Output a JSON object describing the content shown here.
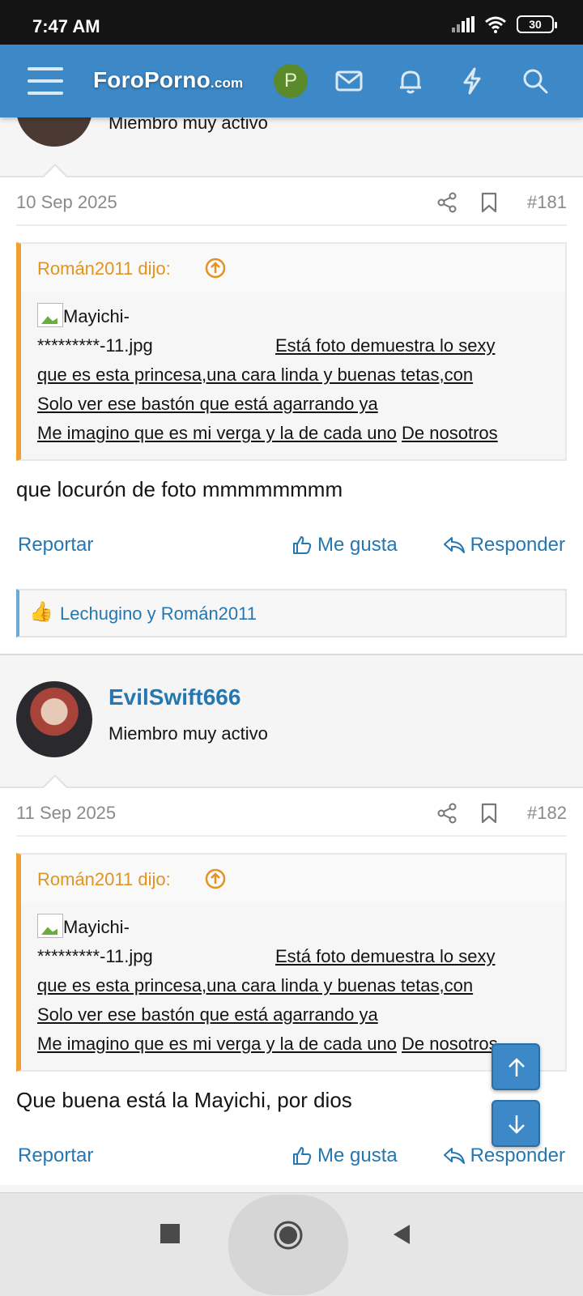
{
  "status_bar": {
    "time": "7:47 AM",
    "battery": "30"
  },
  "header": {
    "logo_main": "ForoPorno",
    "logo_tld": ".com",
    "user_initial": "P"
  },
  "top_user": {
    "title": "Miembro muy activo"
  },
  "posts": [
    {
      "date": "10 Sep 2025",
      "number": "#181",
      "quote": {
        "author": "Román2011 dijo:",
        "image_alt_1": "Mayichi-",
        "image_alt_2": "*********-11.jpg",
        "line1_tail": "Está foto demuestra lo sexy",
        "line2": "que es esta princesa,una cara linda y buenas tetas,con",
        "line3": "Solo ver ese bastón que está agarrando ya",
        "line4": "Me imagino que es mi verga y la de cada uno",
        "line5": "De nosotros"
      },
      "text": "que locurón de foto mmmmmmmm",
      "actions": {
        "report": "Reportar",
        "like": "Me gusta",
        "reply": "Responder"
      },
      "reactions": "Lechugino y Román2011"
    },
    {
      "user": {
        "name": "EvilSwift666",
        "title": "Miembro muy activo"
      },
      "date": "11 Sep 2025",
      "number": "#182",
      "quote": {
        "author": "Román2011 dijo:",
        "image_alt_1": "Mayichi-",
        "image_alt_2": "*********-11.jpg",
        "line1_tail": "Está foto demuestra lo sexy",
        "line2": "que es esta princesa,una cara linda y buenas tetas,con",
        "line3": "Solo ver ese bastón que está agarrando ya",
        "line4": "Me imagino que es mi verga y la de cada uno",
        "line5": "De nosotros"
      },
      "text": "Que buena está la Mayichi, por dios",
      "actions": {
        "report": "Reportar",
        "like": "Me gusta",
        "reply": "Responder"
      }
    }
  ],
  "colors": {
    "header_bg": "#3d88c6",
    "link": "#2577b1",
    "quote_accent": "#f0a030",
    "avatar_p": "#5a8a2a"
  },
  "icons": [
    "signal-icon",
    "wifi-icon",
    "battery-icon",
    "menu-icon",
    "mail-icon",
    "bell-icon",
    "bolt-icon",
    "search-icon",
    "share-icon",
    "bookmark-icon",
    "arrow-up-circle-icon",
    "thumbs-up-icon",
    "reply-icon",
    "arrow-up-icon",
    "arrow-down-icon",
    "stop-icon",
    "home-icon",
    "back-icon"
  ]
}
